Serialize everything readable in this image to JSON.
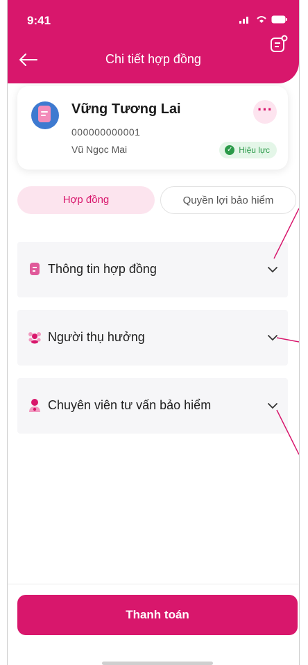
{
  "status_bar": {
    "time": "9:41"
  },
  "header": {
    "title": "Chi tiết hợp đồng"
  },
  "contract_card": {
    "name": "Vững Tương Lai",
    "number": "000000000001",
    "person": "Vũ Ngọc Mai",
    "more_label": "···",
    "status": "Hiệu lực"
  },
  "tabs": [
    {
      "label": "Hợp đồng",
      "active": true
    },
    {
      "label": "Quyền lợi bảo hiểm",
      "active": false
    }
  ],
  "sections": [
    {
      "label": "Thông tin hợp đồng",
      "icon": "document-icon"
    },
    {
      "label": "Người thụ hưởng",
      "icon": "people-icon"
    },
    {
      "label": "Chuyên viên tư vấn bảo hiểm",
      "icon": "advisor-icon"
    }
  ],
  "footer": {
    "pay_label": "Thanh toán"
  },
  "colors": {
    "brand": "#d8176c",
    "status_ok": "#2b9a49"
  }
}
